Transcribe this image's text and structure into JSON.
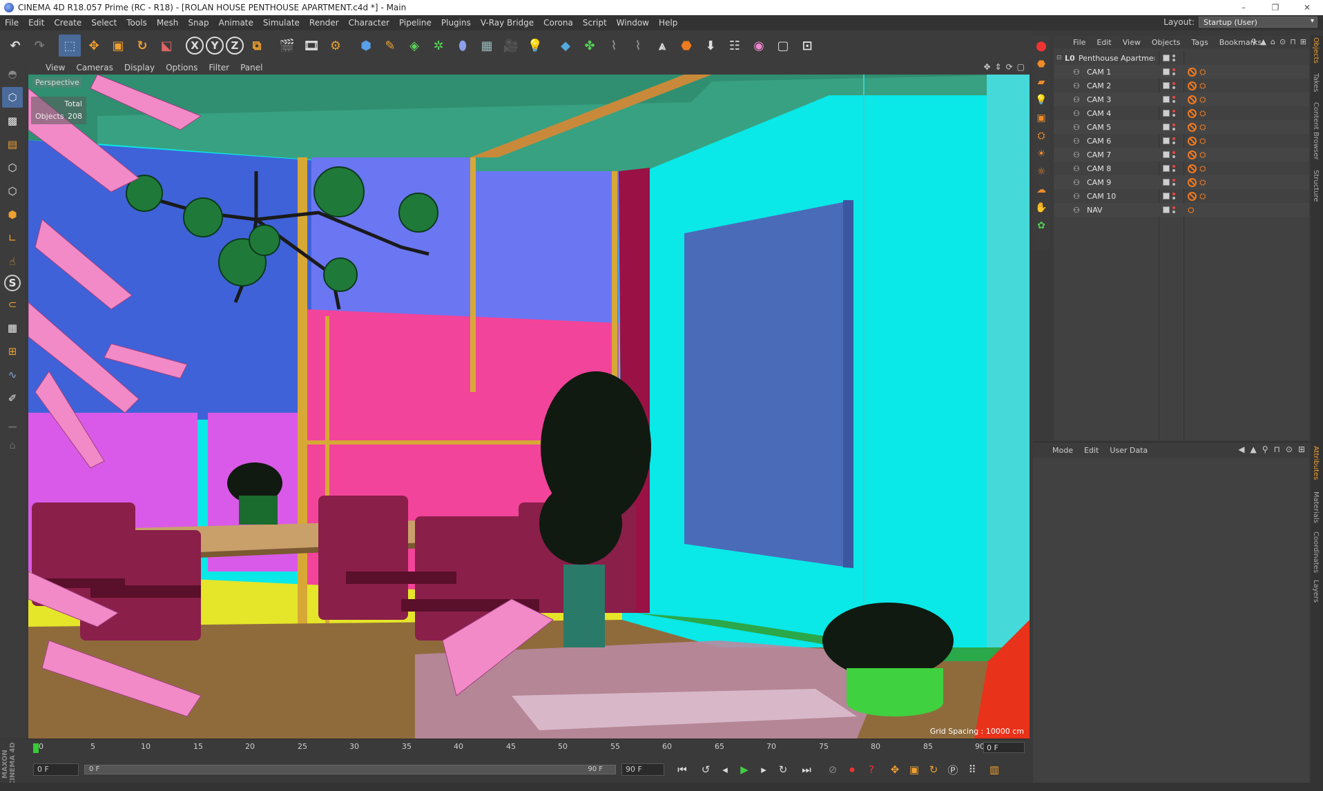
{
  "window": {
    "title": "CINEMA 4D R18.057 Prime (RC - R18) - [ROLAN HOUSE PENTHOUSE APARTMENT.c4d *] - Main",
    "controls": [
      "–",
      "❐",
      "✕"
    ]
  },
  "menubar": {
    "items": [
      "File",
      "Edit",
      "Create",
      "Select",
      "Tools",
      "Mesh",
      "Snap",
      "Animate",
      "Simulate",
      "Render",
      "Character",
      "Pipeline",
      "Plugins",
      "V-Ray Bridge",
      "Corona",
      "Script",
      "Window",
      "Help"
    ],
    "layout_label": "Layout:",
    "layout_value": "Startup (User)"
  },
  "toolbar": {
    "axis_x": "X",
    "axis_y": "Y",
    "axis_z": "Z"
  },
  "viewport": {
    "menu": [
      "View",
      "Cameras",
      "Display",
      "Options",
      "Filter",
      "Panel"
    ],
    "label": "Perspective",
    "stats_header": "Total",
    "stats_objects_label": "Objects",
    "stats_objects_value": "208",
    "grid_spacing": "Grid Spacing : 10000 cm"
  },
  "timeline": {
    "ticks": [
      "0",
      "5",
      "10",
      "15",
      "20",
      "25",
      "30",
      "35",
      "40",
      "45",
      "50",
      "55",
      "60",
      "65",
      "70",
      "75",
      "80",
      "85",
      "90"
    ],
    "current_frame": "0 F"
  },
  "transport": {
    "start_field": "0 F",
    "slider_left": "0 F",
    "slider_right": "90 F",
    "end_field": "90 F"
  },
  "object_manager": {
    "menu": [
      "File",
      "Edit",
      "View",
      "Objects",
      "Tags",
      "Bookmarks"
    ],
    "root": "Penthouse Apartment",
    "children": [
      "CAM 1",
      "CAM 2",
      "CAM 3",
      "CAM 4",
      "CAM 5",
      "CAM 6",
      "CAM 7",
      "CAM 8",
      "CAM 9",
      "CAM 10",
      "NAV"
    ]
  },
  "attribute_manager": {
    "menu": [
      "Mode",
      "Edit",
      "User Data"
    ]
  },
  "side_tabs": {
    "top": [
      "Objects",
      "Takes",
      "Content Browser",
      "Structure"
    ],
    "bottom": [
      "Attributes",
      "Materials",
      "Coordinates",
      "Layers"
    ]
  },
  "logo": "MAXON CINEMA 4D",
  "colors": {
    "accent": "#f07a20",
    "panel_bg": "#414141",
    "viewport_cyan": "#0ae8e8"
  }
}
